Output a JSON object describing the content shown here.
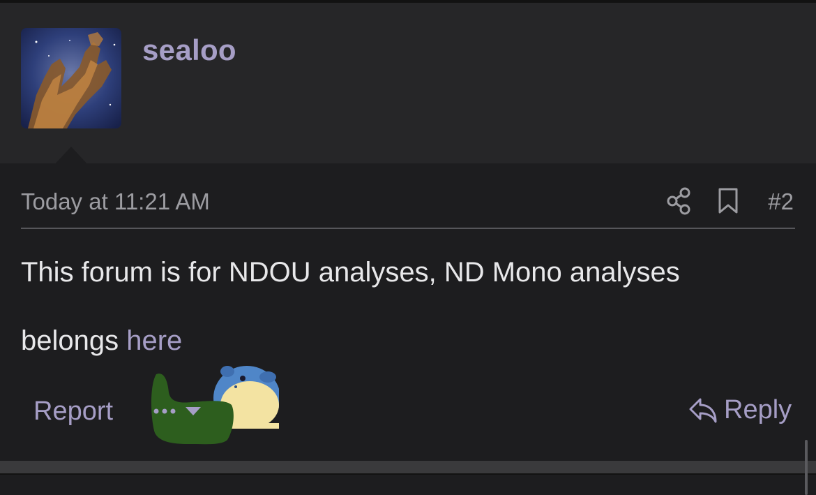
{
  "post": {
    "username": "sealoo",
    "timestamp": "Today at 11:21 AM",
    "number": "#2",
    "body": {
      "line1": "This forum is for NDOU analyses, ND Mono analyses",
      "line2_prefix": "belongs ",
      "link_text": "here"
    },
    "icons": {
      "share": "share-icon",
      "bookmark": "bookmark-icon",
      "more": "more-dots-icon",
      "reply": "reply-arrow-icon"
    }
  },
  "actions": {
    "report_label": "Report",
    "reply_label": "Reply"
  },
  "colors": {
    "background": "#1d1d1f",
    "header_background": "#262628",
    "accent": "#a69ec6",
    "text": "#e8e8ea",
    "muted": "#9c9ca1"
  }
}
